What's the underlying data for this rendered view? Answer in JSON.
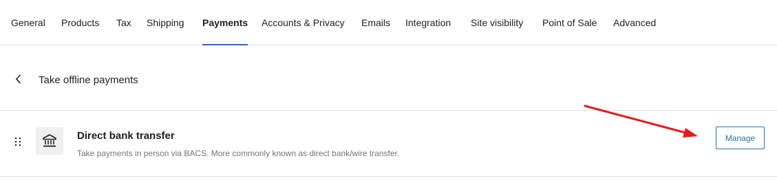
{
  "tabs": [
    {
      "label": "General"
    },
    {
      "label": "Products"
    },
    {
      "label": "Tax"
    },
    {
      "label": "Shipping"
    },
    {
      "label": "Payments",
      "active": true
    },
    {
      "label": "Accounts & Privacy"
    },
    {
      "label": "Emails"
    },
    {
      "label": "Integration"
    },
    {
      "label": "Site visibility"
    },
    {
      "label": "Point of Sale"
    },
    {
      "label": "Advanced"
    }
  ],
  "header": {
    "back_icon": "chevron-left-icon",
    "title": "Take offline payments"
  },
  "method": {
    "drag_icon": "drag-handle-icon",
    "icon": "bank-icon",
    "title": "Direct bank transfer",
    "description": "Take payments in person via BACS. More commonly known as direct bank/wire transfer.",
    "manage_label": "Manage"
  },
  "annotation": {
    "icon": "red-arrow-icon",
    "color": "#e8191a"
  },
  "colors": {
    "accent": "#3858e9",
    "button": "#2271b1",
    "border": "#e0e0e0",
    "muted": "#757575"
  }
}
